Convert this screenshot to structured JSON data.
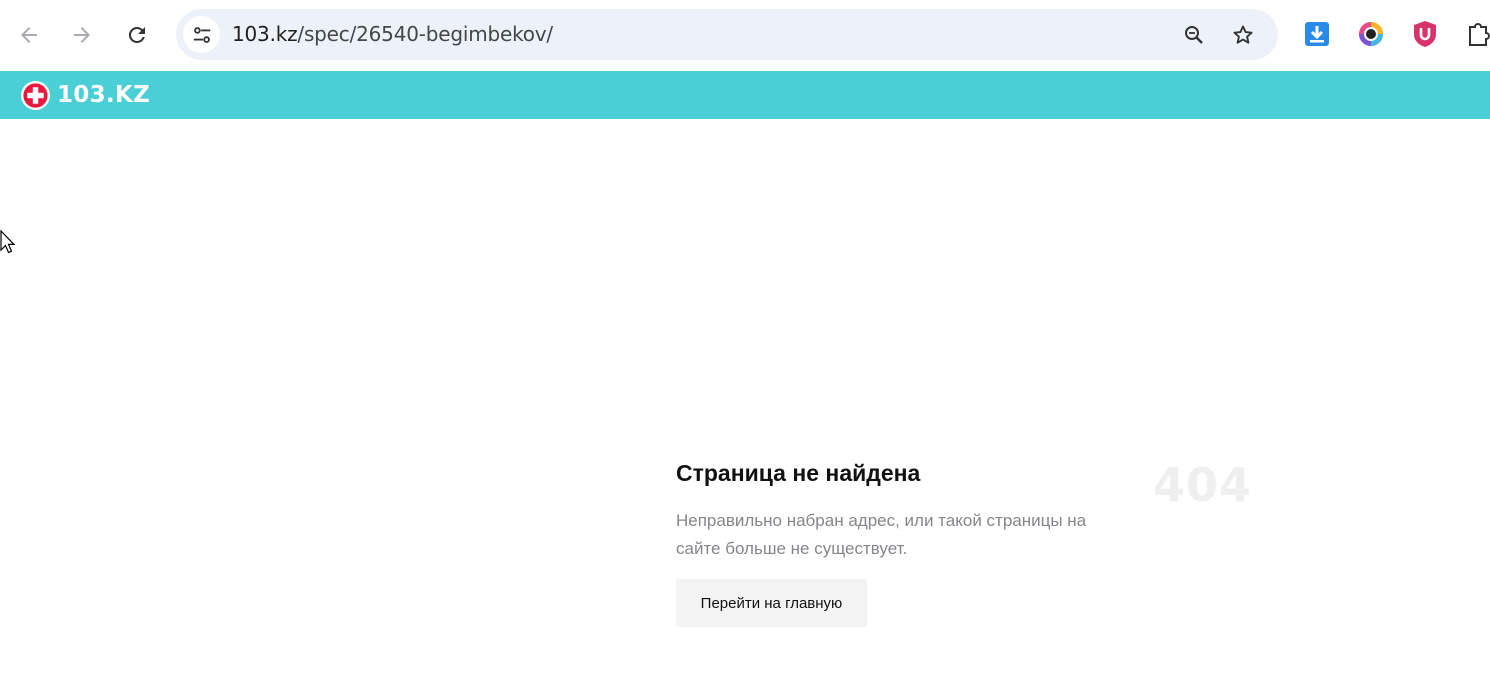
{
  "browser": {
    "url_host": "103.kz",
    "url_path": "/spec/26540-begimbekov/",
    "back_icon": "arrow-left-icon",
    "forward_icon": "arrow-right-icon",
    "reload_icon": "reload-icon",
    "site_info_icon": "tune-icon",
    "zoom_icon": "zoom-icon",
    "bookmark_icon": "star-icon",
    "extensions": [
      "download-extension-icon",
      "color-picker-extension-icon",
      "shield-u-extension-icon",
      "puzzle-extensions-icon"
    ],
    "omnibox_color": "#edf2fa"
  },
  "site": {
    "logo_text": "103.KZ",
    "header_color": "#4acfd7",
    "logo_mark_color": "#e8183f"
  },
  "error_page": {
    "title": "Страница не найдена",
    "description": "Неправильно набран адрес, или такой страницы на сайте больше не существует.",
    "code": "404",
    "home_button_label": "Перейти на главную"
  }
}
